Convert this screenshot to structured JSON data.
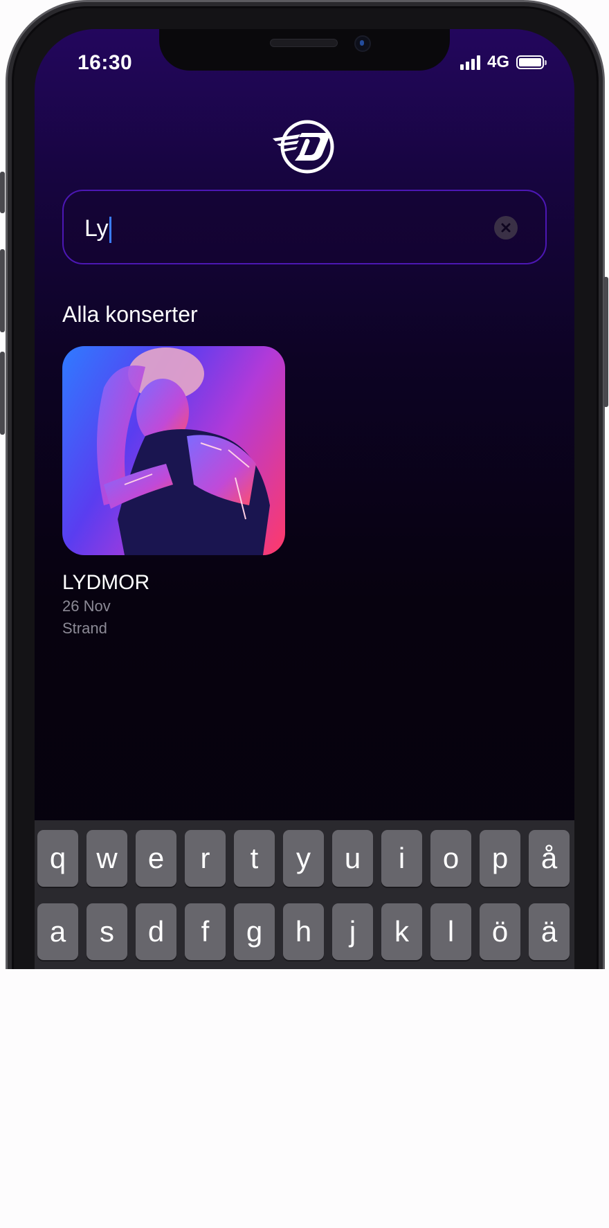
{
  "status_bar": {
    "time": "16:30",
    "network": "4G"
  },
  "search": {
    "value": "Ly",
    "clear_icon": "close-icon"
  },
  "section": {
    "title": "Alla konserter"
  },
  "concerts": [
    {
      "title": "LYDMOR",
      "date": "26 Nov",
      "venue": "Strand",
      "image_icon": "artist-photo"
    }
  ],
  "keyboard": {
    "row1": [
      "q",
      "w",
      "e",
      "r",
      "t",
      "y",
      "u",
      "i",
      "o",
      "p",
      "å"
    ],
    "row2": [
      "a",
      "s",
      "d",
      "f",
      "g",
      "h",
      "j",
      "k",
      "l",
      "ö",
      "ä"
    ]
  },
  "colors": {
    "accent": "#4c17b4",
    "background_top": "#23065d",
    "background_bottom": "#06020c",
    "caret": "#3a7cff"
  }
}
